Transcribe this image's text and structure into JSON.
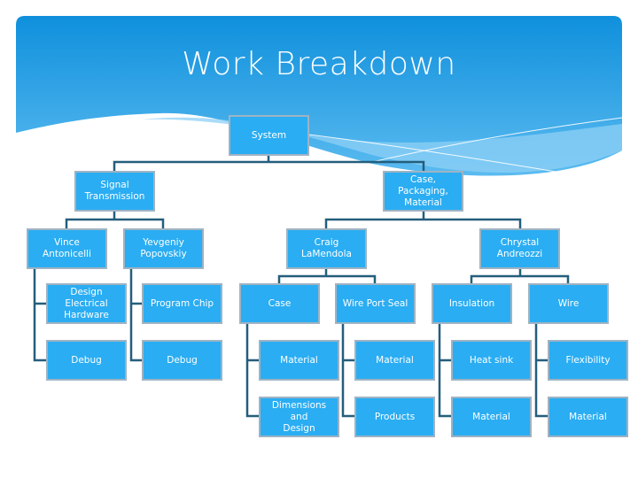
{
  "title": "Work Breakdown",
  "colors": {
    "header_top": "#0f90dc",
    "header_bottom": "#5bbbf0",
    "node_fill": "#2aadf2",
    "node_border": "#9fb3c3",
    "connector": "#245e7c",
    "node_text": "#ffffff"
  },
  "nodes": {
    "system": "System",
    "signal": "Signal\nTransmission",
    "case_pkg": "Case,\nPackaging,\nMaterial",
    "vince": "Vince\nAntonicelli",
    "yevgeniy": "Yevgeniy\nPopovskiy",
    "craig": "Craig\nLaMendola",
    "chrystal": "Chrystal\nAndreozzi",
    "vince_design": "Design\nElectrical\nHardware",
    "vince_debug": "Debug",
    "yev_program": "Program Chip",
    "yev_debug": "Debug",
    "craig_case": "Case",
    "craig_case_material": "Material",
    "craig_case_dimensions": "Dimensions and\nDesign",
    "craig_wire_port": "Wire Port Seal",
    "craig_wire_material": "Material",
    "craig_wire_products": "Products",
    "chrystal_insulation": "Insulation",
    "chrystal_ins_heatsink": "Heat sink",
    "chrystal_ins_material": "Material",
    "chrystal_wire": "Wire",
    "chrystal_wire_flex": "Flexibility",
    "chrystal_wire_material": "Material"
  }
}
